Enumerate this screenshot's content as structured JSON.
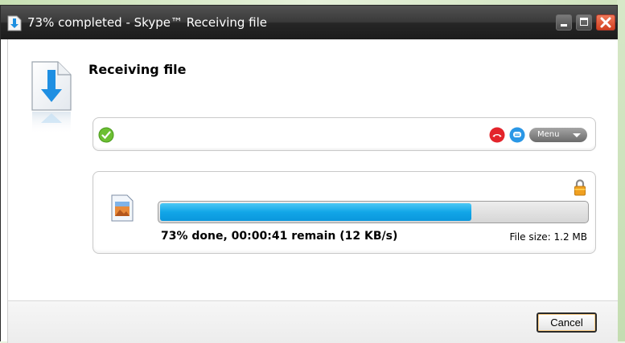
{
  "window": {
    "title": "73% completed - Skype™ Receiving file"
  },
  "header": {
    "title": "Receiving file"
  },
  "contact_bar": {
    "menu_label": "Menu"
  },
  "transfer": {
    "progress_fraction": 0.73,
    "status": "73% done, 00:00:41 remain  (12 KB/s)",
    "file_size": "File size: 1.2 MB"
  },
  "footer": {
    "cancel_label": "Cancel"
  },
  "colors": {
    "progress_fill": "#12a6e8",
    "titlebar": "#2b2b2b",
    "close_button": "#e0502c"
  },
  "icons": {
    "title": "download-arrow-icon",
    "header": "file-download-icon",
    "status": "skype-online-status-icon",
    "call": "end-call-icon",
    "chat": "chat-icon",
    "lock": "lock-icon",
    "file": "image-file-icon"
  }
}
